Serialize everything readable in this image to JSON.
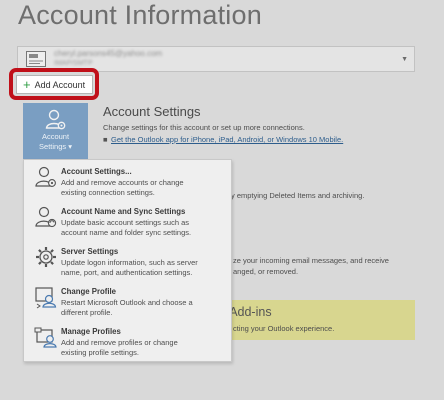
{
  "page": {
    "title": "Account Information"
  },
  "account": {
    "email": "cheryl.parsons45@yahoo.com",
    "type": "IMAP/SMTP",
    "chevron": "▼"
  },
  "add_account": {
    "plus": "+",
    "label": "Add Account"
  },
  "account_settings": {
    "tile_line1": "Account",
    "tile_line2": "Settings ▾",
    "title": "Account Settings",
    "description": "Change settings for this account or set up more connections.",
    "bullet": "■",
    "link": "Get the Outlook app for iPhone, iPad, Android, or Windows 10 Mobile."
  },
  "background_text": {
    "cleanup": "y emptying Deleted Items and archiving.",
    "rules_line1": "ze your incoming email messages, and receive",
    "rules_line2": "anged, or removed."
  },
  "addins": {
    "title": "M Add-ins",
    "description": "cting your Outlook experience."
  },
  "menu": {
    "items": [
      {
        "icon": "account-settings-icon",
        "title": "Account Settings...",
        "desc1": "Add and remove accounts or change",
        "desc2": "existing connection settings."
      },
      {
        "icon": "name-sync-icon",
        "title": "Account Name and Sync Settings",
        "desc1": "Update basic account settings such as",
        "desc2": "account name and folder sync settings."
      },
      {
        "icon": "server-gear-icon",
        "title": "Server Settings",
        "desc1": "Update logon information, such as server",
        "desc2": "name, port, and authentication settings."
      },
      {
        "icon": "change-profile-icon",
        "title": "Change Profile",
        "desc1": "Restart Microsoft Outlook and choose a",
        "desc2": "different profile."
      },
      {
        "icon": "manage-profiles-icon",
        "title": "Manage Profiles",
        "desc1": "Add and remove profiles or change",
        "desc2": "existing profile settings."
      }
    ]
  },
  "colors": {
    "highlight": "#c0101a",
    "tile": "#7a9ec2",
    "banner": "#d8d68f",
    "plus": "#2f9e44",
    "link": "#2d5d8c"
  }
}
